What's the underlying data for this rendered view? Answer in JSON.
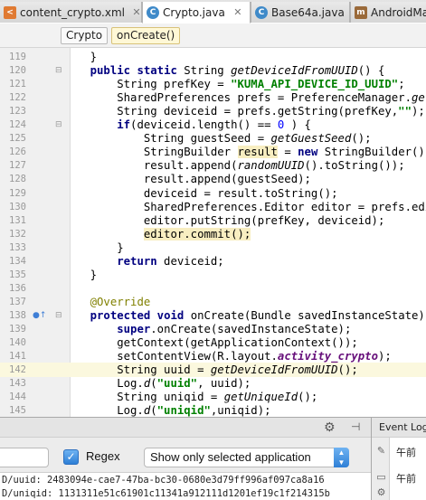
{
  "tabs": [
    {
      "label": "content_crypto.xml",
      "icon": "xml-file-icon",
      "active": false
    },
    {
      "label": "Crypto.java",
      "icon": "class-file-icon",
      "active": true
    },
    {
      "label": "Base64a.java",
      "icon": "class-file-icon",
      "active": false
    },
    {
      "label": "AndroidMa",
      "icon": "android-manifest-icon",
      "active": false
    }
  ],
  "breadcrumb": {
    "class_name": "Crypto",
    "method_name": "onCreate()"
  },
  "editor": {
    "caret_line": "142",
    "lines": [
      {
        "n": "119",
        "t": "    }"
      },
      {
        "n": "120",
        "t": "    public static String getDeviceIdFromUUID() {"
      },
      {
        "n": "121",
        "t": "        String prefKey = \"KUMA_API_DEVICE_ID_UUID\";"
      },
      {
        "n": "122",
        "t": "        SharedPreferences prefs = PreferenceManager.getDe"
      },
      {
        "n": "123",
        "t": "        String deviceid = prefs.getString(prefKey,\"\");"
      },
      {
        "n": "124",
        "t": "        if(deviceid.length() == 0 ) {"
      },
      {
        "n": "125",
        "t": "            String guestSeed = getGuestSeed();"
      },
      {
        "n": "126",
        "t": "            StringBuilder result = new StringBuilder();"
      },
      {
        "n": "127",
        "t": "            result.append(randomUUID().toString());"
      },
      {
        "n": "128",
        "t": "            result.append(guestSeed);"
      },
      {
        "n": "129",
        "t": "            deviceid = result.toString();"
      },
      {
        "n": "130",
        "t": "            SharedPreferences.Editor editor = prefs.edit("
      },
      {
        "n": "131",
        "t": "            editor.putString(prefKey, deviceid);"
      },
      {
        "n": "132",
        "t": "            editor.commit();"
      },
      {
        "n": "133",
        "t": "        }"
      },
      {
        "n": "134",
        "t": "        return deviceid;"
      },
      {
        "n": "135",
        "t": "    }"
      },
      {
        "n": "136",
        "t": ""
      },
      {
        "n": "137",
        "t": "    @Override"
      },
      {
        "n": "138",
        "t": "    protected void onCreate(Bundle savedInstanceState) {"
      },
      {
        "n": "139",
        "t": "        super.onCreate(savedInstanceState);"
      },
      {
        "n": "140",
        "t": "        getContext(getApplicationContext());"
      },
      {
        "n": "141",
        "t": "        setContentView(R.layout.activity_crypto);"
      },
      {
        "n": "142",
        "t": "        String uuid = getDeviceIdFromUUID();"
      },
      {
        "n": "143",
        "t": "        Log.d(\"uuid\", uuid);"
      },
      {
        "n": "144",
        "t": "        String uniqid = getUniqueId();"
      },
      {
        "n": "145",
        "t": "        Log.d(\"uniqid\",uniqid);"
      }
    ]
  },
  "logcat": {
    "regex_label": "Regex",
    "regex_checked": true,
    "filter_select": "Show only selected application",
    "lines": [
      "D/uuid: 2483094e-cae7-47ba-bc30-0680e3d79ff996af097ca8a16",
      "D/uniqid: 1131311e51c61901c11341a912111d1201ef19c1f214315b"
    ]
  },
  "event_log": {
    "title": "Event Log",
    "entries": [
      "午前",
      "午前"
    ]
  }
}
